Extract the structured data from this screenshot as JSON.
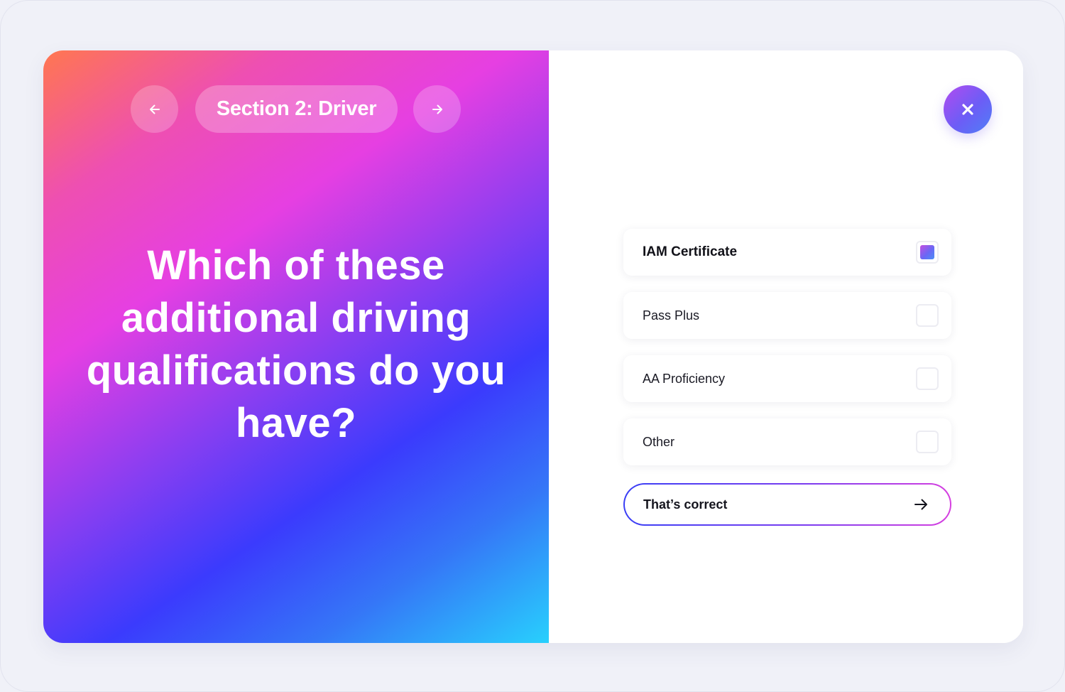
{
  "header": {
    "section_label": "Section 2: Driver"
  },
  "question": {
    "text": "Which of these additional driving qualifications do you have?"
  },
  "options": [
    {
      "label": "IAM Certificate",
      "checked": true
    },
    {
      "label": "Pass Plus",
      "checked": false
    },
    {
      "label": "AA Proficiency",
      "checked": false
    },
    {
      "label": "Other",
      "checked": false
    }
  ],
  "confirm": {
    "label": "That’s correct"
  },
  "icons": {
    "prev": "arrow-left-icon",
    "next": "arrow-right-icon",
    "close": "close-icon",
    "confirm": "arrow-right-icon"
  },
  "colors": {
    "gradient_start": "#ff7750",
    "gradient_mid": "#e63fe2",
    "gradient_blue": "#3b3bfd",
    "gradient_end": "#28d0fd",
    "accent": "#6c5df6"
  }
}
